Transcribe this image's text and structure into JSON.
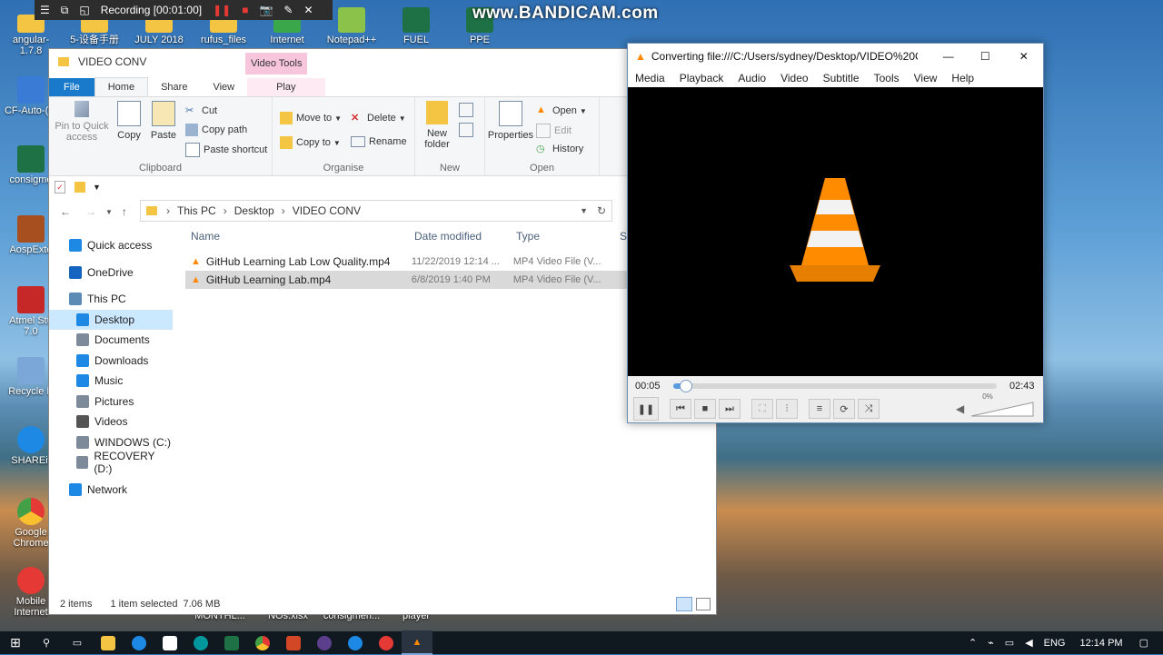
{
  "bandicam": {
    "recording_label": "Recording [00:01:00]",
    "watermark": "www.BANDICAM.com"
  },
  "desktop_icons": [
    {
      "label": "angular-1.7.8",
      "color": "#f4c542"
    },
    {
      "label": "5-设备手册",
      "color": "#f4c542"
    },
    {
      "label": "JULY 2018",
      "color": "#f4c542"
    },
    {
      "label": "rufus_files",
      "color": "#f4c542"
    },
    {
      "label": "Internet",
      "color": "#3aa74b"
    },
    {
      "label": "Notepad++",
      "color": "#8bc34a"
    },
    {
      "label": "FUEL",
      "color": "#1e7145"
    },
    {
      "label": "PPE",
      "color": "#1e7145"
    },
    {
      "label": "CF-Auto-(1)",
      "color": "#3a7bd5"
    },
    {
      "label": "consigme",
      "color": "#1e7145"
    },
    {
      "label": "AospExte",
      "color": "#a84f1f"
    },
    {
      "label": "Atmel Stu 7.0",
      "color": "#c62828"
    },
    {
      "label": "Recycle B",
      "color": "#7aa7d8"
    },
    {
      "label": "SHAREit",
      "color": "#1e88e5"
    },
    {
      "label": "Google Chrome",
      "color": "#e53935"
    },
    {
      "label": "Mobile Internet",
      "color": "#e53935"
    },
    {
      "label": "MONTHL...",
      "color": "#1e7145"
    },
    {
      "label": "NOs.xlsx",
      "color": "#1e7145"
    },
    {
      "label": "consigmen...",
      "color": "#1e7145"
    },
    {
      "label": "player",
      "color": "#ff8800"
    }
  ],
  "explorer": {
    "title": "VIDEO CONV",
    "context_tab": "Video Tools",
    "tabs": [
      "File",
      "Home",
      "Share",
      "View",
      "Play"
    ],
    "clipboard": {
      "pin": "Pin to Quick access",
      "copy": "Copy",
      "paste": "Paste",
      "cut": "Cut",
      "copy_path": "Copy path",
      "paste_shortcut": "Paste shortcut",
      "label": "Clipboard"
    },
    "organise": {
      "move_to": "Move to",
      "copy_to": "Copy to",
      "delete": "Delete",
      "rename": "Rename",
      "label": "Organise"
    },
    "new": {
      "new_folder": "New folder",
      "label": "New"
    },
    "open": {
      "properties": "Properties",
      "open": "Open",
      "edit": "Edit",
      "history": "History",
      "label": "Open"
    },
    "breadcrumb": [
      "This PC",
      "Desktop",
      "VIDEO CONV"
    ],
    "nav": [
      {
        "label": "Quick access",
        "color": "#1e88e5",
        "indent": false
      },
      {
        "label": "OneDrive",
        "color": "#1565c0",
        "indent": false
      },
      {
        "label": "This PC",
        "color": "#5c8bb5",
        "indent": false
      },
      {
        "label": "Desktop",
        "color": "#1e88e5",
        "indent": true,
        "selected": true
      },
      {
        "label": "Documents",
        "color": "#7d8a99",
        "indent": true
      },
      {
        "label": "Downloads",
        "color": "#1e88e5",
        "indent": true
      },
      {
        "label": "Music",
        "color": "#1e88e5",
        "indent": true
      },
      {
        "label": "Pictures",
        "color": "#7d8a99",
        "indent": true
      },
      {
        "label": "Videos",
        "color": "#555555",
        "indent": true
      },
      {
        "label": "WINDOWS (C:)",
        "color": "#7d8a99",
        "indent": true
      },
      {
        "label": "RECOVERY (D:)",
        "color": "#7d8a99",
        "indent": true
      },
      {
        "label": "Network",
        "color": "#1e88e5",
        "indent": false
      }
    ],
    "columns": [
      "Name",
      "Date modified",
      "Type",
      "Si"
    ],
    "files": [
      {
        "name": "GitHub Learning Lab Low Quality.mp4",
        "date": "11/22/2019 12:14 ...",
        "type": "MP4 Video File (V...",
        "selected": false
      },
      {
        "name": "GitHub Learning Lab.mp4",
        "date": "6/8/2019 1:40 PM",
        "type": "MP4 Video File (V...",
        "selected": true
      }
    ],
    "status": {
      "items": "2 items",
      "selected": "1 item selected",
      "size": "7.06 MB"
    }
  },
  "vlc": {
    "title": "Converting file:///C:/Users/sydney/Desktop/VIDEO%20CO...",
    "menu": [
      "Media",
      "Playback",
      "Audio",
      "Video",
      "Subtitle",
      "Tools",
      "View",
      "Help"
    ],
    "elapsed": "00:05",
    "total": "02:43",
    "progress": 0.031,
    "volume_label": "0%"
  },
  "taskbar": {
    "lang": "ENG",
    "time": "12:14 PM"
  }
}
